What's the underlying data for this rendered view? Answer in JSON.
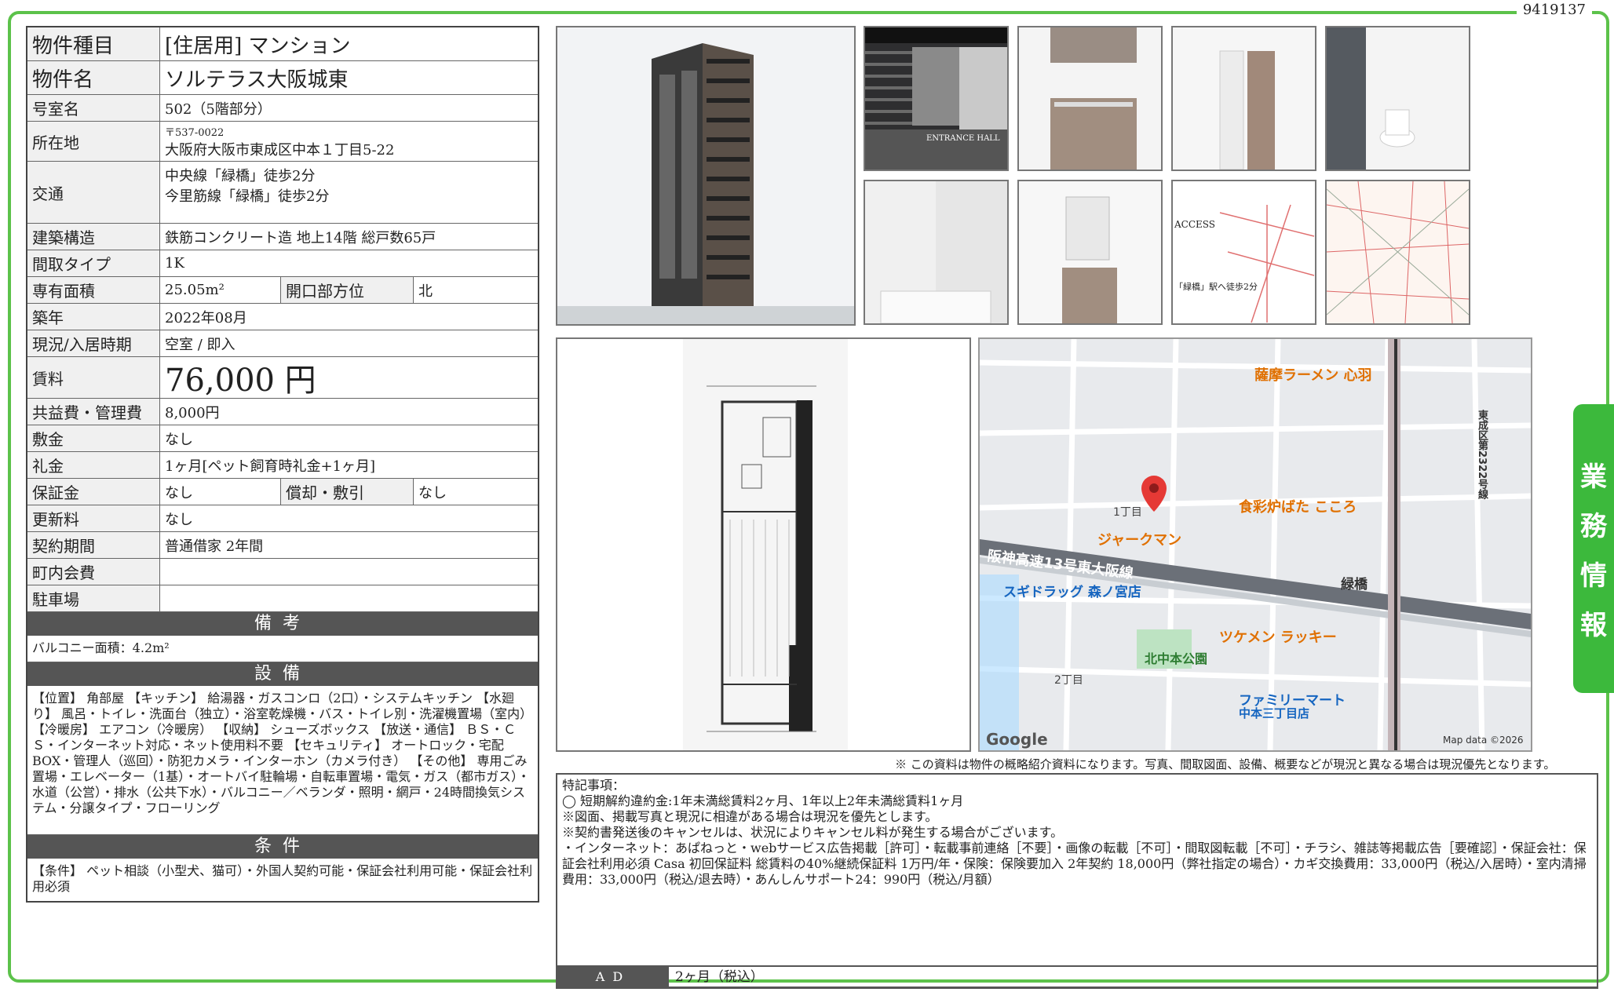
{
  "doc_id": "9419137",
  "side_tab": [
    "業",
    "務",
    "情",
    "報"
  ],
  "specs": {
    "type_label": "物件種目",
    "type_value": "[住居用] マンション",
    "name_label": "物件名",
    "name_value": "ソルテラス大阪城東",
    "room_label": "号室名",
    "room_value": "502（5階部分）",
    "addr_label": "所在地",
    "addr_zip": "〒537-0022",
    "addr_value": "大阪府大阪市東成区中本１丁目5-22",
    "transit_label": "交通",
    "transit_1": "中央線「緑橋」徒歩2分",
    "transit_2": "今里筋線「緑橋」徒歩2分",
    "structure_label": "建築構造",
    "structure_value": "鉄筋コンクリート造 地上14階 総戸数65戸",
    "layout_label": "間取タイプ",
    "layout_value": "1K",
    "area_label": "専有面積",
    "area_value": "25.05m²",
    "dir_label": "開口部方位",
    "dir_value": "北",
    "built_label": "築年",
    "built_value": "2022年08月",
    "status_label": "現況/入居時期",
    "status_value": "空室 / 即入",
    "rent_label": "賃料",
    "rent_value": "76,000 円",
    "fee_label": "共益費・管理費",
    "fee_value": "8,000円",
    "deposit_label": "敷金",
    "deposit_value": "なし",
    "key_label": "礼金",
    "key_value": "1ヶ月[ペット飼育時礼金+1ヶ月]",
    "guarantee_label": "保証金",
    "guarantee_value": "なし",
    "amort_label": "償却・敷引",
    "amort_value": "なし",
    "renew_label": "更新料",
    "renew_value": "なし",
    "term_label": "契約期間",
    "term_value": "普通借家 2年間",
    "assoc_label": "町内会費",
    "assoc_value": "",
    "parking_label": "駐車場",
    "parking_value": ""
  },
  "remarks_head": "備考",
  "remarks_text": "バルコニー面積：4.2m²",
  "equip_head": "設備",
  "equip_text": "【位置】 角部屋 【キッチン】 給湯器・ガスコンロ（2口）・システムキッチン 【水廻り】 風呂・トイレ・洗面台（独立）・浴室乾燥機・バス・トイレ別・洗濯機置場（室内） 【冷暖房】 エアコン（冷暖房） 【収納】 シューズボックス 【放送・通信】 ＢＳ・ＣＳ・インターネット対応・ネット使用料不要 【セキュリティ】 オートロック・宅配BOX・管理人（巡回）・防犯カメラ・インターホン（カメラ付き） 【その他】 専用ごみ置場・エレベーター（1基）・オートバイ駐輪場・自転車置場・電気・ガス（都市ガス）・水道（公営）・排水（公共下水）・バルコニー／ベランダ・照明・網戸・24時間換気システム・分譲タイプ・フローリング",
  "cond_head": "条件",
  "cond_text": "【条件】 ペット相談（小型犬、猫可）・外国人契約可能・保証会社利用可能・保証会社利用必須",
  "photo_labels": {
    "entrance": "ENTRANCE HALL",
    "access": "ACCESS",
    "access_sub": "「緑橋」駅へ徒歩2分"
  },
  "map": {
    "labels": [
      "薩摩ラーメン 心羽",
      "食彩炉ばた こころ",
      "ジャークマン",
      "阪神高速13号東大阪線",
      "スギドラッグ 森ノ宮店",
      "緑橋",
      "ツケメン ラッキー",
      "北中本公園",
      "ファミリーマート",
      "中本三丁目店",
      "1丁目",
      "2丁目",
      "東成区第2322号線",
      "Google",
      "Map data ©2026"
    ]
  },
  "disclaimer": "※ この資料は物件の概略紹介資料になります。写真、間取図面、設備、概要などが現況と異なる場合は現況優先となります。",
  "notes": {
    "title": "特記事項：",
    "l1": "◯ 短期解約違約金:1年未満総賃料2ヶ月、1年以上2年未満総賃料1ヶ月",
    "l2": "※図面、掲載写真と現況に相違がある場合は現況を優先とします。",
    "l3": "※契約書発送後のキャンセルは、状況によりキャンセル料が発生する場合がございます。",
    "l4": "・インターネット：あぱねっと・webサービス広告掲載［許可］・転載事前連絡［不要］・画像の転載［不可］・間取図転載［不可］・チラシ、雑誌等掲載広告［要確認］・保証会社：保証会社利用必須 Casa 初回保証料 総賃料の40%継続保証料 1万円/年・保険：保険要加入 2年契約 18,000円（弊社指定の場合）・カギ交換費用：33,000円（税込/入居時）・室内清掃費用：33,000円（税込/退去時）・あんしんサポート24：990円（税込/月額）"
  },
  "ad_label": "AD",
  "ad_value": "2ヶ月（税込）"
}
